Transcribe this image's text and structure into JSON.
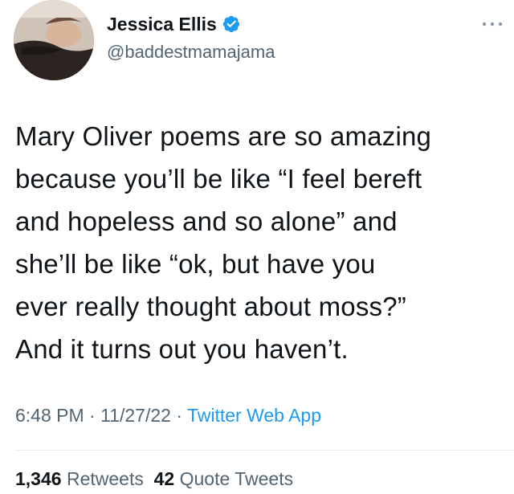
{
  "author": {
    "display_name": "Jessica Ellis",
    "handle": "@baddestmamajama",
    "verified": true,
    "avatar_icon": "profile-photo"
  },
  "tweet": {
    "lines": [
      "Mary Oliver poems are so amazing",
      "because you’ll be like “I feel bereft",
      "and hopeless and so alone” and",
      "she’ll be like “ok, but have you",
      "ever really thought about moss?”",
      "And it turns out you haven’t."
    ]
  },
  "meta": {
    "time": "6:48 PM",
    "sep1": " · ",
    "date": "11/27/22",
    "sep2": " · ",
    "source": "Twitter Web App"
  },
  "stats": {
    "retweets_count": "1,346",
    "retweets_label": "Retweets",
    "quotes_count": "42",
    "quotes_label": "Quote Tweets"
  },
  "colors": {
    "accent": "#1d9bf0",
    "muted_text": "#536471",
    "primary_text": "#0f1419"
  }
}
